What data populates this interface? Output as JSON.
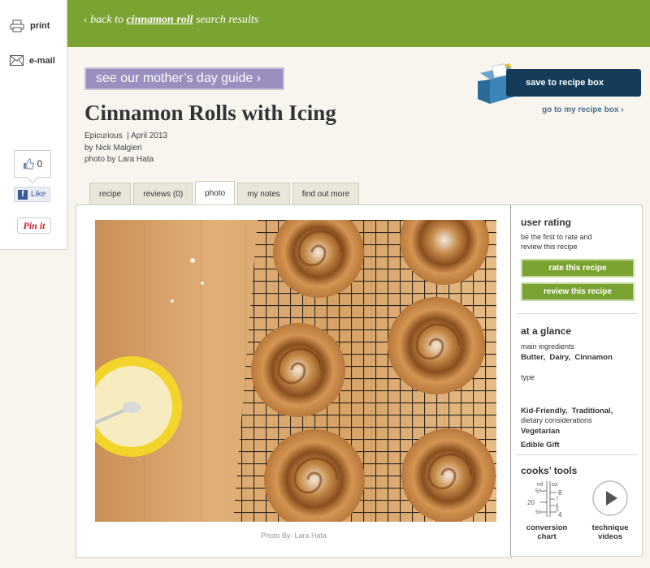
{
  "rail": {
    "print_label": "print",
    "email_label": "e-mail",
    "like_count": "0",
    "fb_like_label": "Like",
    "fb_logo": "f",
    "pinit_label": "Pin it"
  },
  "header": {
    "back_prefix": "‹ back to ",
    "back_term": "cinnamon roll",
    "back_suffix": " search results",
    "bg_color": "#7ba332"
  },
  "promo": {
    "label": "see our mother’s day guide ›"
  },
  "recipe": {
    "title": "Cinnamon Rolls with Icing",
    "source": "Epicurious  | April 2013",
    "author": "by Nick Malgieri",
    "photo_credit": "photo by Lara Hata"
  },
  "recipe_box": {
    "save_label": "save to recipe box",
    "goto_label": "go to my recipe box ›"
  },
  "tabs": [
    {
      "label": "recipe",
      "active": false
    },
    {
      "label": "reviews (0)",
      "active": false
    },
    {
      "label": "photo",
      "active": true
    },
    {
      "label": "my notes",
      "active": false
    },
    {
      "label": "find out more",
      "active": false
    }
  ],
  "photo": {
    "caption": "Photo By: Lara Hata"
  },
  "sidebar": {
    "rating_title": "user rating",
    "rating_line1": "be the first to rate and",
    "rating_line2": "review this recipe",
    "rate_button": "rate this recipe",
    "review_button": "review this recipe",
    "glance_title": "at a glance",
    "main_ingredients_label": "main ingredients",
    "main_ingredients": "Butter,  Dairy,  Cinnamon",
    "type_label": "type",
    "type_line1": "Kid-Friendly,  Traditional,",
    "type_line2": "Edible Gift",
    "dietary_label": "dietary considerations",
    "dietary": "Vegetarian",
    "tools_title": "cooks’ tools",
    "conversion_line1": "conversion",
    "conversion_line2": "chart",
    "technique_line1": "technique",
    "technique_line2": "videos",
    "gauge": {
      "ml": "ml",
      "oz": "oz",
      "v50a": "50",
      "v20": "20",
      "v50b": "50",
      "o8": "8",
      "o7": "7",
      "o6": "6",
      "o5": "5",
      "o4": "4"
    }
  }
}
